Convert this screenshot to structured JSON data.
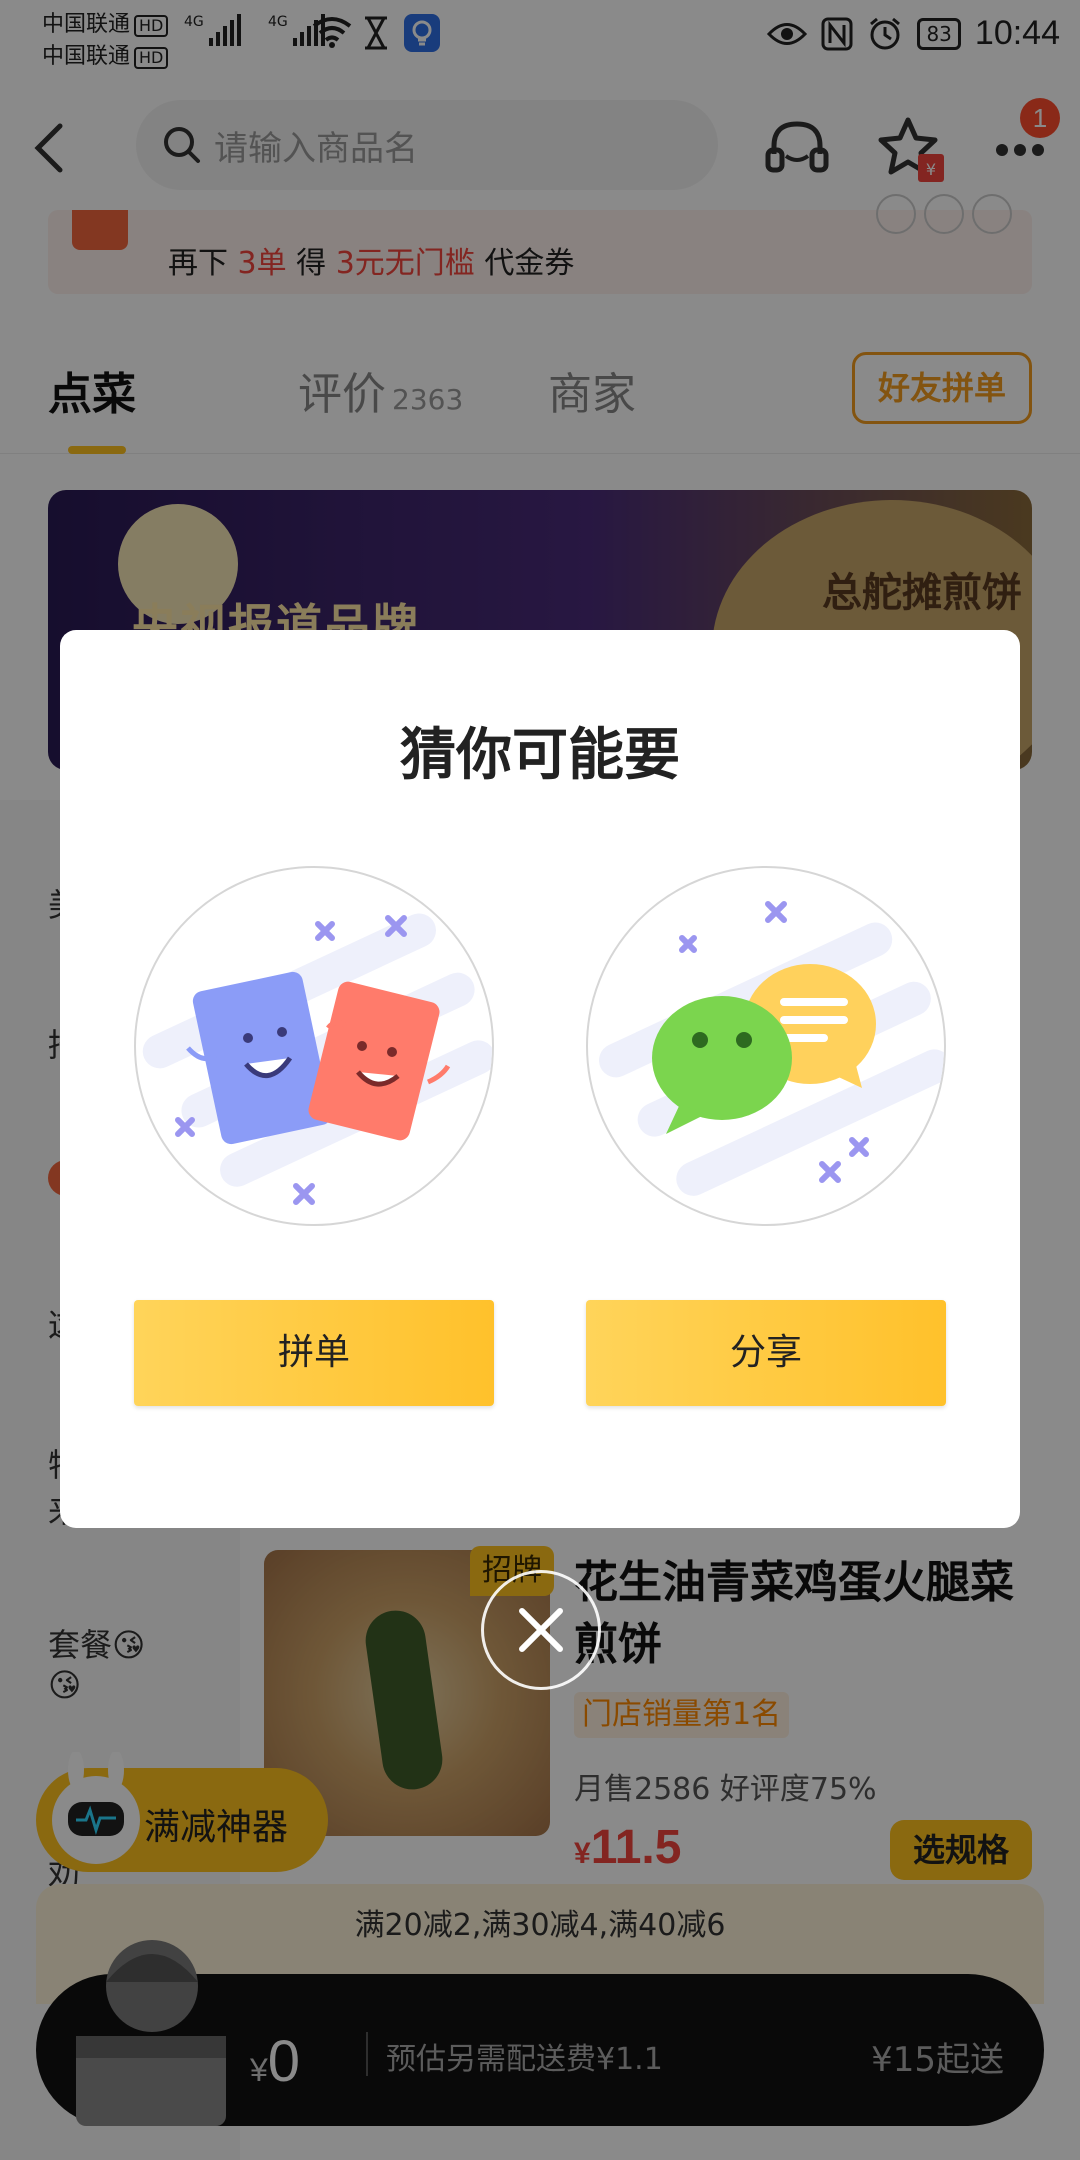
{
  "status_bar": {
    "carrier1": "中国联通",
    "carrier2": "中国联通",
    "hd": "HD",
    "net1": "4G",
    "net2": "4G",
    "battery": "83",
    "time": "10:44"
  },
  "header": {
    "search_placeholder": "请输入商品名",
    "notification_count": "1"
  },
  "promo": {
    "p1": "再下 ",
    "n1": "3单",
    "p2": " 得 ",
    "n2": "3元无门槛",
    "p3": " 代金券"
  },
  "tabs": {
    "order": "点菜",
    "reviews": "评价",
    "reviews_count": "2363",
    "merchant": "商家",
    "group_button": "好友拼单"
  },
  "banner": {
    "text": "央视报道品牌",
    "right_text": "总舵摊煎饼"
  },
  "sidebar": {
    "items": [
      "美",
      "招",
      "",
      "这",
      "特",
      "来",
      "套餐😘",
      "😘",
      "劝"
    ]
  },
  "product": {
    "sign_tag": "招牌",
    "name": "花生油青菜鸡蛋火腿菜煎饼",
    "rank_tag": "门店销量第1名",
    "stats": "月售2586  好评度75%",
    "currency": "¥",
    "price": "11.5",
    "spec_button": "选规格"
  },
  "floating_promo": {
    "label": "满减神器"
  },
  "discount": {
    "text": "满20减2,满30减4,满40减6"
  },
  "cart": {
    "currency": "¥",
    "total": "0",
    "fee_text": "预估另需配送费¥1.1",
    "min_order": "¥15起送"
  },
  "modal": {
    "title": "猜你可能要",
    "option_group_label": "拼单",
    "option_share_label": "分享"
  },
  "colors": {
    "accent": "#ffc21f",
    "price_red": "#f2453d",
    "orange": "#f29b1e"
  }
}
